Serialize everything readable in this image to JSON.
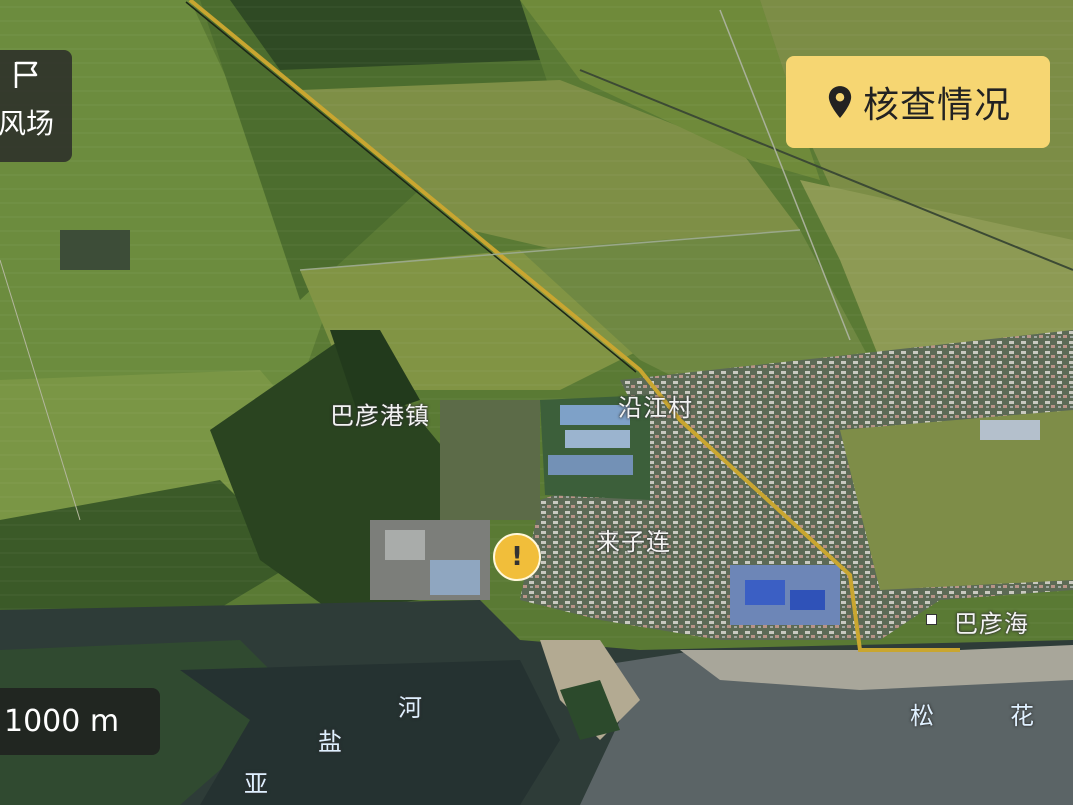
{
  "top_left_panel": {
    "icon": "flag-icon",
    "label": "风场"
  },
  "check_button": {
    "icon": "location-pin-icon",
    "label": "核查情况"
  },
  "scale": {
    "label": "1000 m"
  },
  "map": {
    "labels": {
      "bayangang": "巴彦港镇",
      "yanjiang": "沿江村",
      "laizilian": "来子连",
      "bayanhai": "巴彦海",
      "he": "河",
      "yan": "盐",
      "ya": "亚",
      "song": "松",
      "hua": "花"
    },
    "alert_marker": "!",
    "colors": {
      "check_button_bg": "#f6d672",
      "marker": "#f1be3a",
      "road": "#c9a630"
    }
  }
}
